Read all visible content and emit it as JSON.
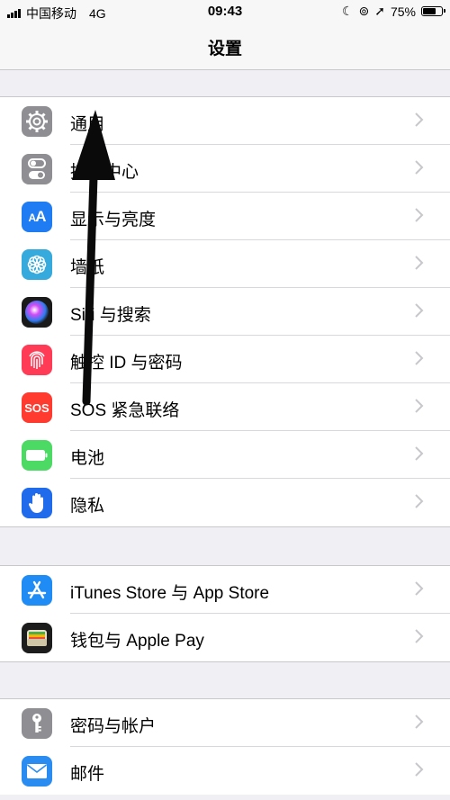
{
  "status_bar": {
    "carrier": "中国移动",
    "network": "4G",
    "time": "09:43",
    "battery": "75%",
    "battery_level": 0.75
  },
  "nav": {
    "title": "设置"
  },
  "groups": [
    {
      "items": [
        {
          "label": "通用",
          "icon": "gear-icon",
          "color": "#8e8e93"
        },
        {
          "label": "控制中心",
          "icon": "toggles-icon",
          "color": "#8e8e93"
        },
        {
          "label": "显示与亮度",
          "icon": "text-size-icon",
          "color": "#1f7cf2"
        },
        {
          "label": "墙纸",
          "icon": "flower-icon",
          "color": "#36aadc"
        },
        {
          "label": "Siri 与搜索",
          "icon": "siri-icon",
          "color": "#1a1a1a"
        },
        {
          "label": "触控 ID 与密码",
          "icon": "fingerprint-icon",
          "color": "#ff3b55"
        },
        {
          "label": "SOS 紧急联络",
          "icon": "sos-icon",
          "color": "#ff3b30"
        },
        {
          "label": "电池",
          "icon": "battery-icon",
          "color": "#4cd964"
        },
        {
          "label": "隐私",
          "icon": "hand-icon",
          "color": "#1f6bec"
        }
      ]
    },
    {
      "items": [
        {
          "label": "iTunes Store 与 App Store",
          "icon": "app-store-icon",
          "color": "#1f8cf6"
        },
        {
          "label": "钱包与 Apple Pay",
          "icon": "wallet-icon",
          "color": "#1c1c1c"
        }
      ]
    },
    {
      "items": [
        {
          "label": "密码与帐户",
          "icon": "key-icon",
          "color": "#8e8e93"
        },
        {
          "label": "邮件",
          "icon": "mail-icon",
          "color": "#2a8cf0"
        }
      ]
    }
  ]
}
